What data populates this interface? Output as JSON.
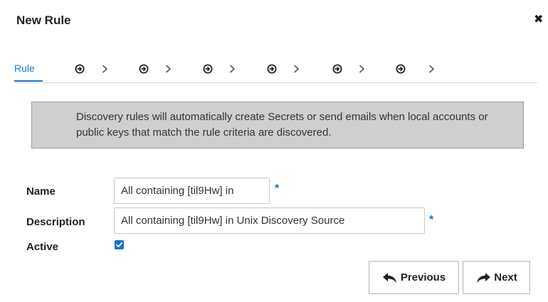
{
  "dialog": {
    "title": "New Rule",
    "close_icon": "close-icon",
    "close_glyph": "✖"
  },
  "tabs": {
    "active": {
      "label": "Rule"
    },
    "steps": [
      {
        "icon": "circle-arrow-right-icon"
      },
      {
        "icon": "circle-arrow-right-icon"
      },
      {
        "icon": "circle-arrow-right-icon"
      },
      {
        "icon": "circle-arrow-right-icon"
      },
      {
        "icon": "circle-arrow-right-icon"
      },
      {
        "icon": "circle-arrow-right-icon"
      }
    ],
    "separator_icon": "chevron-right-icon"
  },
  "info": {
    "text": "Discovery rules will automatically create Secrets or send emails when local accounts or public keys that match the rule criteria are discovered."
  },
  "form": {
    "name": {
      "label": "Name",
      "value": "All containing [til9Hw] in",
      "required_mark": "*"
    },
    "description": {
      "label": "Description",
      "value": "All containing [til9Hw] in Unix Discovery Source",
      "required_mark": "*"
    },
    "active": {
      "label": "Active",
      "checked": true
    }
  },
  "buttons": {
    "previous": {
      "label": "Previous",
      "icon": "reply-arrow-icon"
    },
    "next": {
      "label": "Next",
      "icon": "share-arrow-icon"
    }
  },
  "colors": {
    "accent": "#1a73c9",
    "info_bg": "#cfcfcf",
    "info_border": "#9b9b9b"
  }
}
